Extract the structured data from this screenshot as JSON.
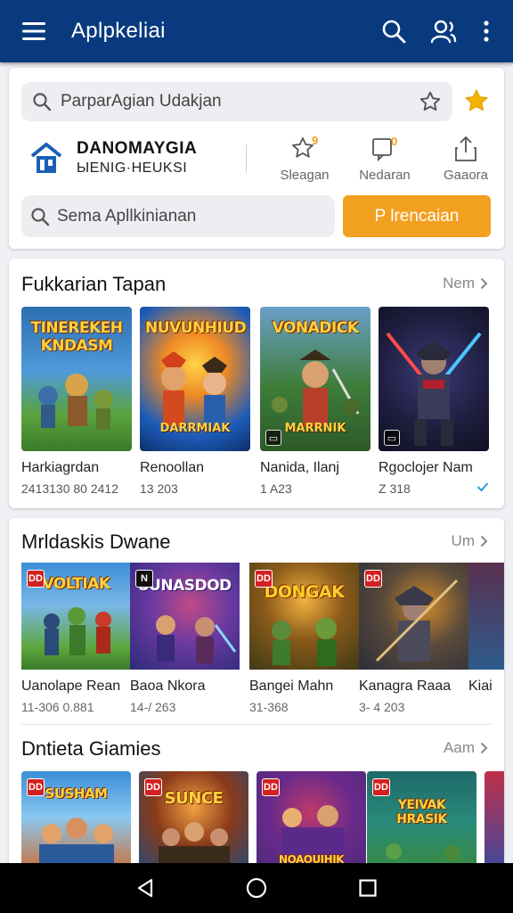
{
  "appbar": {
    "title": "Aplpkeliai",
    "menu_icon": "menu-icon",
    "search_icon": "search-icon",
    "account_icon": "account-icon",
    "more_icon": "more-vert-icon"
  },
  "top_search": {
    "placeholder": "ParparAgian Udakjan"
  },
  "developer": {
    "name": "DANOMAYGIA",
    "subtitle": "ЫЕNIG·НEUKSI"
  },
  "quick_actions": [
    {
      "label": "Sleagan",
      "badge": "9"
    },
    {
      "label": "Nedaran",
      "badge": "0"
    },
    {
      "label": "Gaaora"
    }
  ],
  "app_search": {
    "placeholder": "Sema Apllkinianan",
    "button_label": "P lrencaian"
  },
  "featured": {
    "title": "Fukkarian Tapan",
    "more_label": "Nem",
    "items": [
      {
        "name": "Harkiagrdan",
        "meta": "2413130 80 2412",
        "art_text": "TINEREKEH KNDASM",
        "colors": [
          "#2d6fb3",
          "#5aa33c"
        ]
      },
      {
        "name": "Renoollan",
        "meta": "13 203",
        "art_text": "NUVUNHIUD",
        "art_sub": "DARRMIAK",
        "colors": [
          "#1c5bb8",
          "#d24a1f"
        ]
      },
      {
        "name": "Nanida, Ilanj",
        "meta": "1 A23",
        "art_text": "VONADICK",
        "art_sub": "MARRNIK",
        "colors": [
          "#3f7d3a",
          "#b8402a"
        ]
      },
      {
        "name": "Rgoclojer Nam",
        "meta": "Z 318",
        "colors": [
          "#1e1d3d",
          "#b22030"
        ]
      }
    ]
  },
  "row2": {
    "title": "Mrldaskis Dwane",
    "more_label": "Um",
    "items": [
      {
        "name": "Uanolape Rean",
        "meta": "11-306 0.881",
        "art_text": "VOLTIAK",
        "badge": "DD",
        "colors": [
          "#3b8fd6",
          "#5ca63b"
        ]
      },
      {
        "name": "Baoa Nkora",
        "meta": "14-/ 263",
        "art_text": "SUNASDOD",
        "badge": "N",
        "colors": [
          "#2c2a7a",
          "#c04a86"
        ]
      },
      {
        "name": "Bangei Mahn",
        "meta": "31-368",
        "art_text": "DONGAK",
        "badge": "DD",
        "colors": [
          "#5c3b16",
          "#3f7b2c"
        ]
      },
      {
        "name": "Kanagra Raaa",
        "meta": "3- 4 203",
        "badge": "DD",
        "colors": [
          "#2b2d3a",
          "#d08a2a"
        ]
      },
      {
        "name": "Kiai",
        "meta": "",
        "colors": [
          "#5a3050",
          "#2e5b8c"
        ]
      }
    ]
  },
  "row3": {
    "title": "Dntieta Giamies",
    "more_label": "Aam",
    "items": [
      {
        "art_text": "SUSHAM",
        "badge": "DD",
        "colors": [
          "#3a8ed8",
          "#d0682a"
        ]
      },
      {
        "art_text": "SUNCE",
        "badge": "DD",
        "colors": [
          "#1f4b7a",
          "#8a3a1a"
        ]
      },
      {
        "art_text": "NOAOUIHIK",
        "badge": "DD",
        "colors": [
          "#4a2a7a",
          "#c03a6a"
        ]
      },
      {
        "art_text": "YEIVAK HRASIK",
        "badge": "DD",
        "colors": [
          "#1f6a6a",
          "#3a8a3a"
        ]
      },
      {
        "art_text": "",
        "colors": [
          "#c0304a",
          "#3a4aa0"
        ]
      }
    ]
  },
  "navbar": {
    "back_icon": "back-icon",
    "home_icon": "home-icon",
    "recents_icon": "recents-icon"
  }
}
